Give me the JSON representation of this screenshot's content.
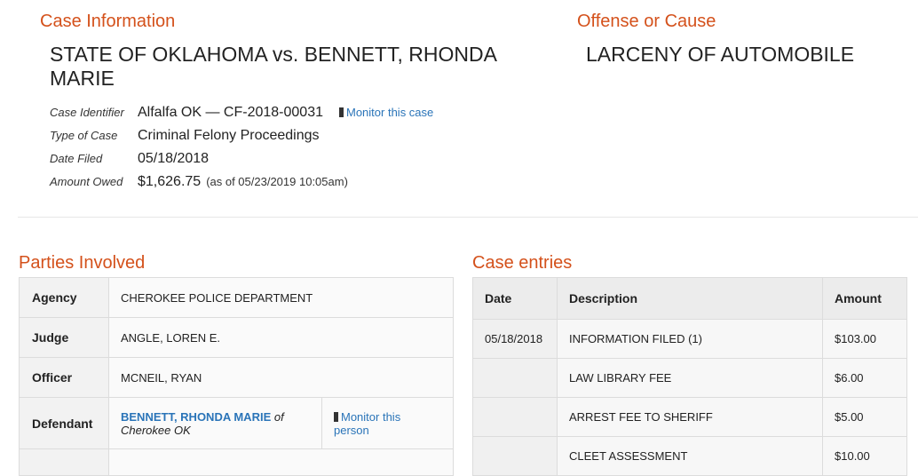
{
  "case_info": {
    "heading": "Case Information",
    "title": "STATE OF OKLAHOMA vs. BENNETT, RHONDA MARIE",
    "identifier_label": "Case Identifier",
    "identifier_value": "Alfalfa OK — CF-2018-00031",
    "monitor_case_label": "Monitor this case",
    "type_label": "Type of Case",
    "type_value": "Criminal Felony Proceedings",
    "date_label": "Date Filed",
    "date_value": "05/18/2018",
    "amount_label": "Amount Owed",
    "amount_value": "$1,626.75",
    "amount_as_of": "(as of 05/23/2019 10:05am)"
  },
  "offense": {
    "heading": "Offense or Cause",
    "text": "LARCENY OF AUTOMOBILE"
  },
  "parties": {
    "heading": "Parties Involved",
    "agency_label": "Agency",
    "agency_value": "CHEROKEE POLICE DEPARTMENT",
    "judge_label": "Judge",
    "judge_value": "ANGLE, LOREN E.",
    "officer_label": "Officer",
    "officer_value": "MCNEIL, RYAN",
    "defendant_label": "Defendant",
    "defendant_name": "BENNETT, RHONDA MARIE",
    "defendant_of": "of",
    "defendant_location": "Cherokee OK",
    "monitor_person_line1": "Monitor this",
    "monitor_person_line2": "person"
  },
  "entries": {
    "heading": "Case entries",
    "columns": [
      "Date",
      "Description",
      "Amount"
    ],
    "rows": [
      {
        "date": "05/18/2018",
        "description": "INFORMATION FILED (1)",
        "amount": "$103.00"
      },
      {
        "date": "",
        "description": "LAW LIBRARY FEE",
        "amount": "$6.00"
      },
      {
        "date": "",
        "description": "ARREST FEE TO SHERIFF",
        "amount": "$5.00"
      },
      {
        "date": "",
        "description": "CLEET ASSESSMENT",
        "amount": "$10.00"
      }
    ]
  },
  "colors": {
    "heading": "#d4511b",
    "link": "#2a74b8"
  }
}
